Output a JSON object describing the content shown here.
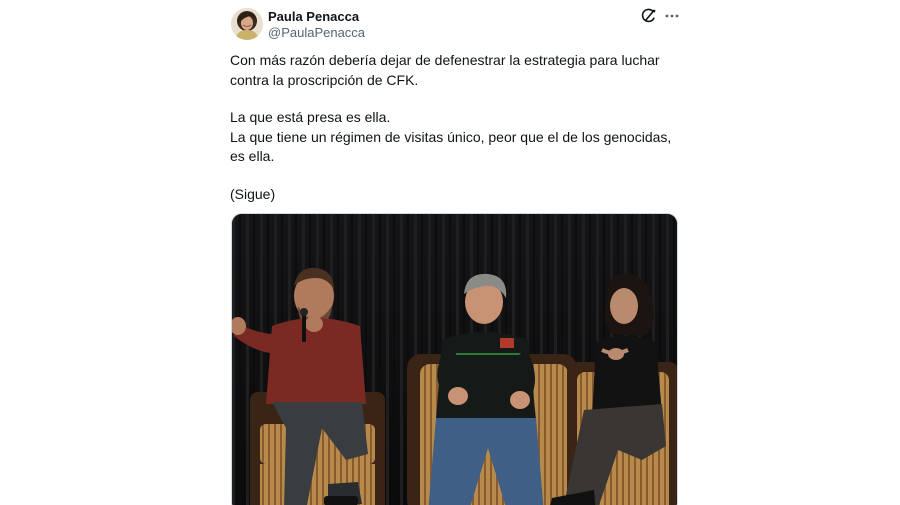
{
  "author": {
    "display_name": "Paula Penacca",
    "handle": "@PaulaPenacca",
    "avatar": "avatar"
  },
  "header_icons": {
    "grok": "grok-icon",
    "more": "more-icon"
  },
  "tweet": {
    "paragraphs": [
      [
        "Con más razón debería dejar de defenestrar la estrategia para luchar",
        "contra la proscripción de CFK."
      ],
      [
        "La que está presa es ella.",
        "La que tiene un régimen de visitas único, peor que el de los genocidas,",
        "es ella."
      ],
      [
        "(Sigue)"
      ]
    ]
  },
  "media": {
    "kind": "photo"
  },
  "colors": {
    "text": "#0f1419",
    "secondary": "#536471",
    "border": "#cfd9de"
  }
}
